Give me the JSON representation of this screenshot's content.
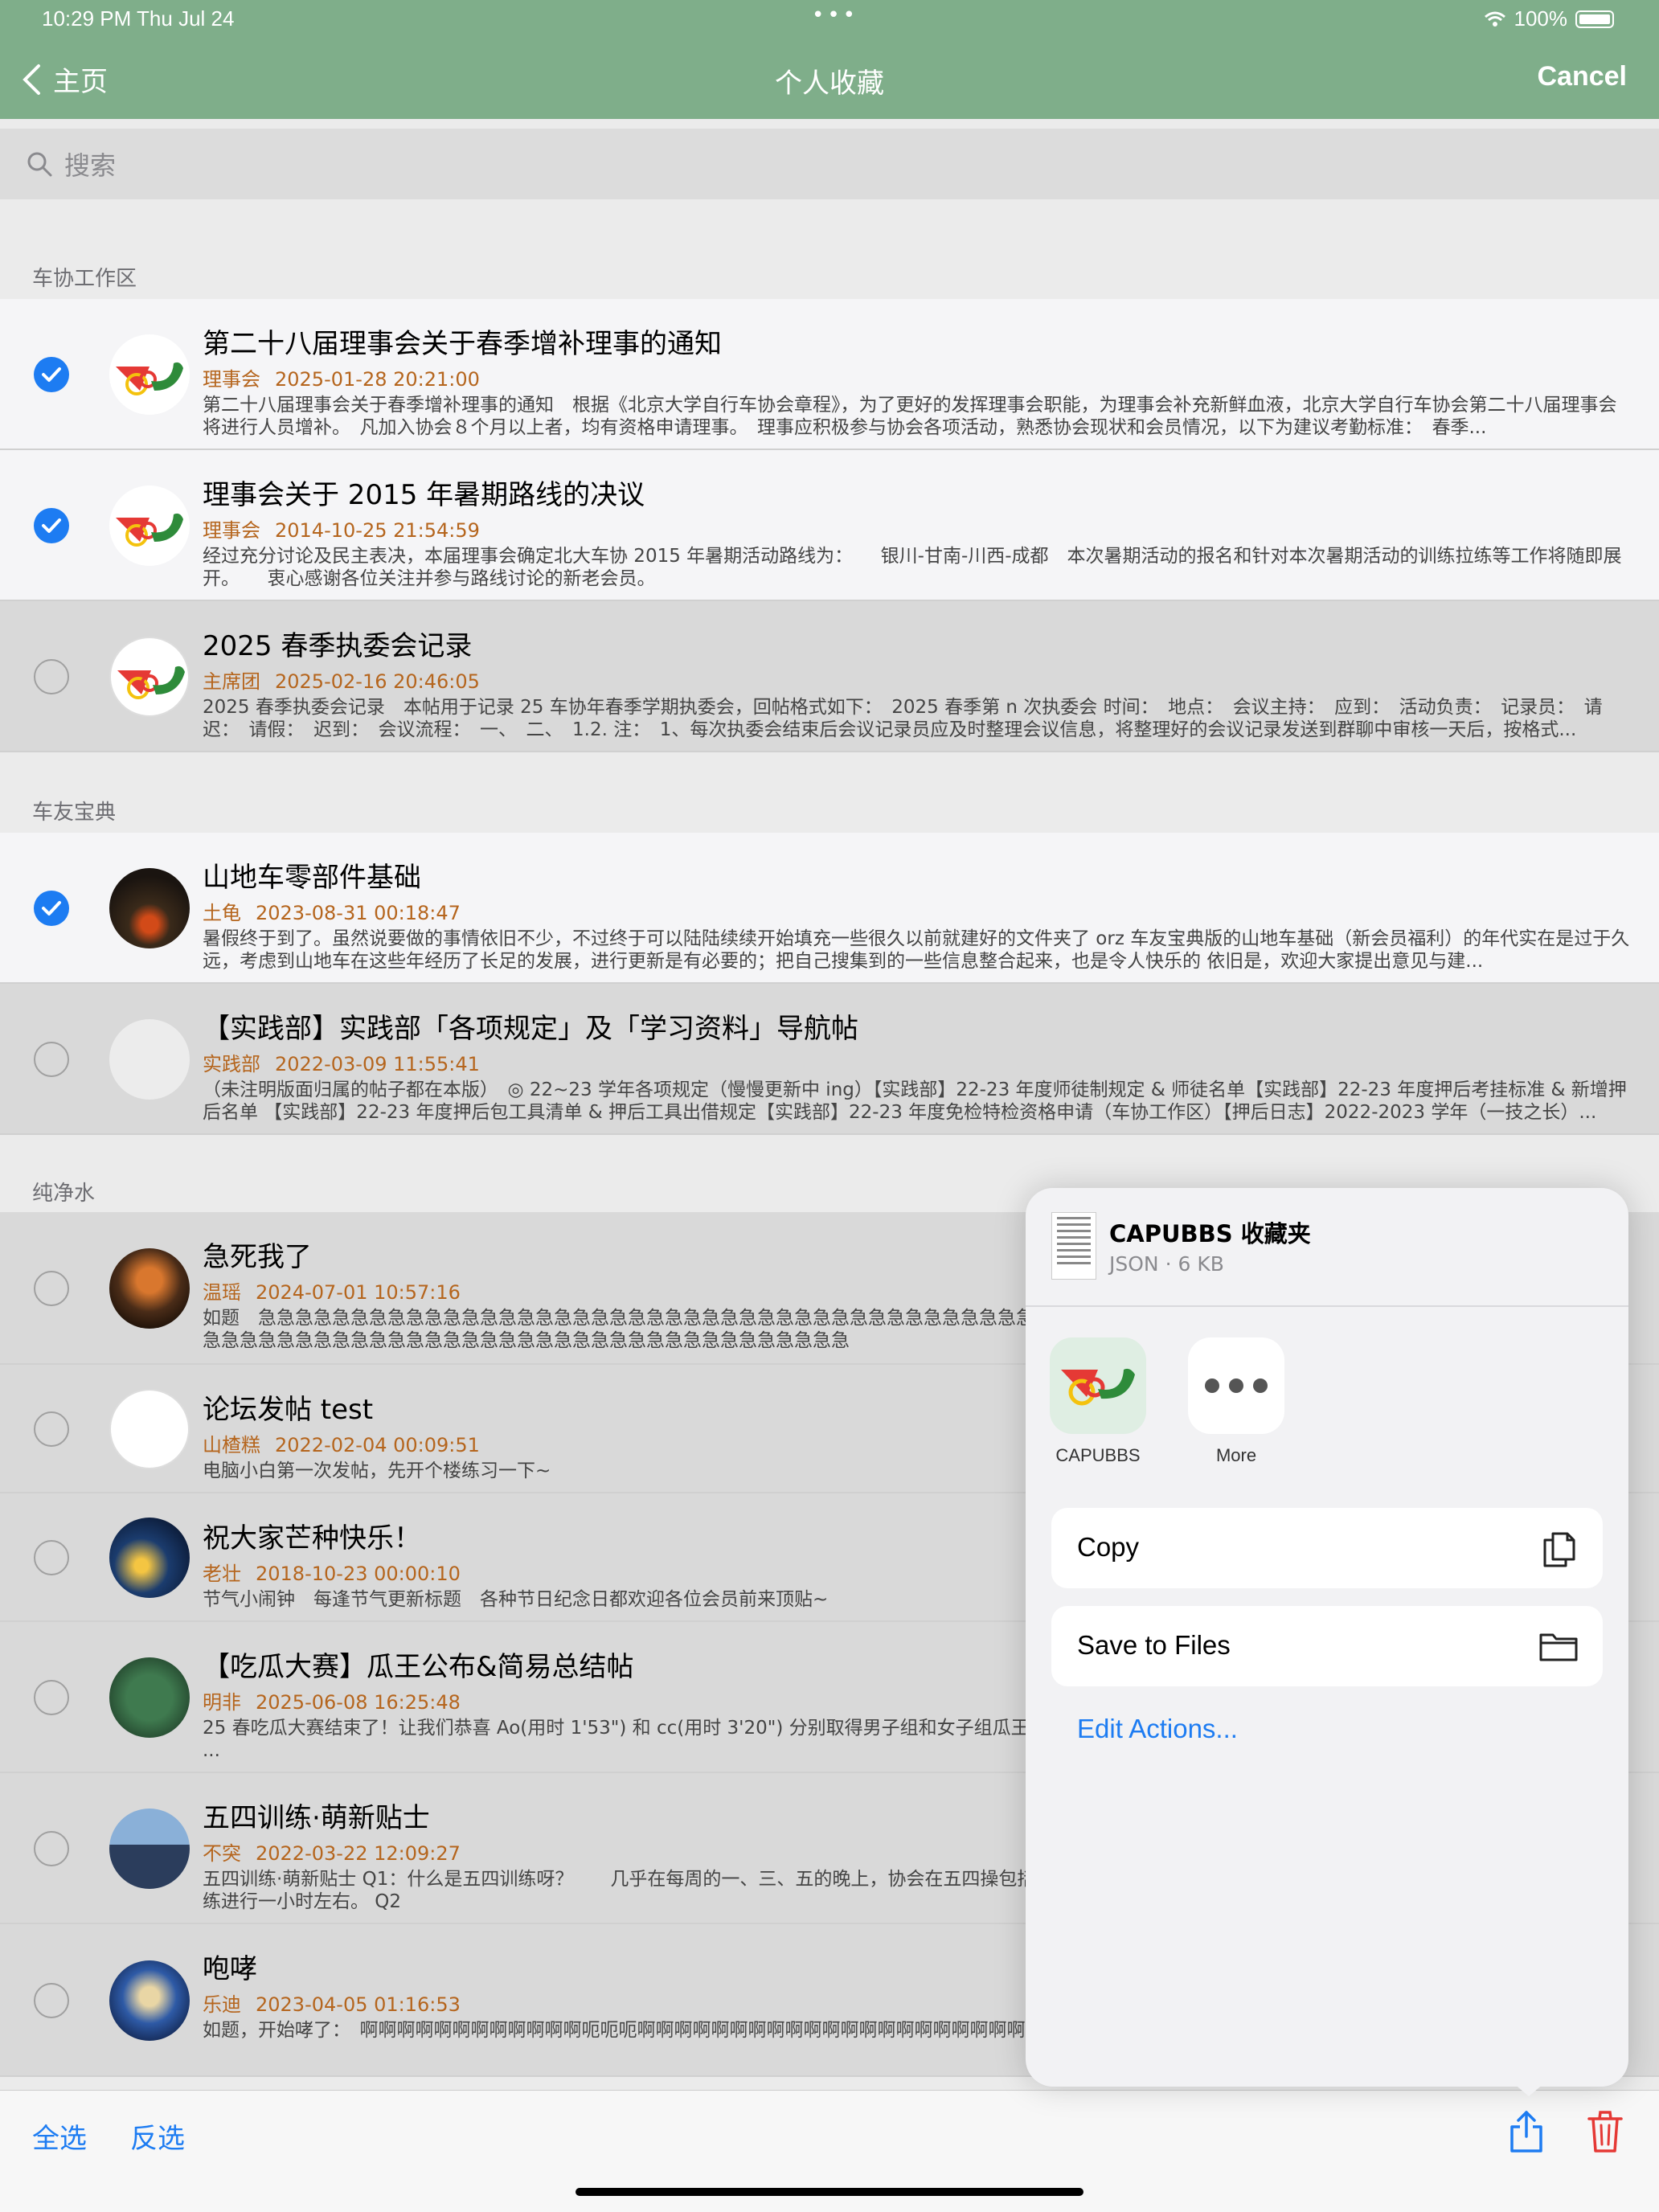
{
  "status": {
    "time": "10:29 PM   Thu Jul 24",
    "battery": "100%"
  },
  "nav": {
    "back_label": "主页",
    "title": "个人收藏",
    "cancel_label": "Cancel"
  },
  "search": {
    "placeholder": "搜索"
  },
  "sections": [
    {
      "header": "车协工作区"
    },
    {
      "header": "车友宝典"
    },
    {
      "header": "纯净水"
    }
  ],
  "rows": [
    {
      "title": "第二十八届理事会关于春季增补理事的通知",
      "author": "理事会",
      "time": "2025-01-28 20:21:00",
      "summary": "第二十八届理事会关于春季增补理事的通知　根据《北京大学自行车协会章程》，为了更好的发挥理事会职能，为理事会补充新鲜血液，北京大学自行车协会第二十八届理事会将进行人员增补。　凡加入协会８个月以上者，均有资格申请理事。　理事应积极参与协会各项活动，熟悉协会现状和会员情况，以下为建议考勤标准：　春季...",
      "selected": true
    },
    {
      "title": "理事会关于 2015 年暑期路线的决议",
      "author": "理事会",
      "time": "2014-10-25 21:54:59",
      "summary": "经过充分讨论及民主表决，本届理事会确定北大车协 2015 年暑期活动路线为：　　银川-甘南-川西-成都　本次暑期活动的报名和针对本次暑期活动的训练拉练等工作将随即展开。　　衷心感谢各位关注并参与路线讨论的新老会员。",
      "selected": true
    },
    {
      "title": "2025 春季执委会记录",
      "author": "主席团",
      "time": "2025-02-16 20:46:05",
      "summary": "2025 春季执委会记录　本帖用于记录 25 车协年春季学期执委会，回帖格式如下：　2025 春季第 n 次执委会 时间：　地点：　会议主持：　应到：　活动负责：　记录员：　请迟：　请假：　迟到：　会议流程：　一、　二、　1.2. 注：　1、每次执委会结束后会议记录员应及时整理会议信息，将整理好的会议记录发送到群聊中审核一天后，按格式...",
      "selected": false
    },
    {
      "title": "山地车零部件基础",
      "author": "土龟",
      "time": "2023-08-31 00:18:47",
      "summary": "暑假终于到了。虽然说要做的事情依旧不少，不过终于可以陆陆续续开始填充一些很久以前就建好的文件夹了 orz 车友宝典版的山地车基础（新会员福利）的年代实在是过于久远，考虑到山地车在这些年经历了长足的发展，进行更新是有必要的；把自己搜集到的一些信息整合起来，也是令人快乐的 依旧是，欢迎大家提出意见与建...",
      "selected": true
    },
    {
      "title": "【实践部】实践部「各项规定」及「学习资料」导航帖",
      "author": "实践部",
      "time": "2022-03-09 11:55:41",
      "summary": "（未注明版面归属的帖子都在本版）　◎ 22~23 学年各项规定（慢慢更新中 ing）【实践部】22-23 年度师徒制规定 & 师徒名单【实践部】22-23 年度押后考挂标准 & 新增押后名单 【实践部】22-23 年度押后包工具清单 & 押后工具出借规定【实践部】22-23 年度免检特检资格申请（车协工作区）【押后日志】2022-2023 学年（一技之长）...",
      "selected": false
    },
    {
      "title": "急死我了",
      "author": "温瑶",
      "time": "2024-07-01 10:57:16",
      "summary": "如题　急急急急急急急急急急急急急急急急急急急急急急急急急急急急急急急急急急急急急急急急急急急急急急急急急急急急急急急急急急急急急急急急急急急急急急急急急急急急急急急急急急急急急急急急急急急急急急急急急急急急急急急急急急急急急",
      "selected": false
    },
    {
      "title": "论坛发帖 test",
      "author": "山楂糕",
      "time": "2022-02-04 00:09:51",
      "summary": "电脑小白第一次发帖，先开个楼练习一下~",
      "selected": false
    },
    {
      "title": "祝大家芒种快乐！",
      "author": "老壮",
      "time": "2018-10-23 00:00:10",
      "summary": "节气小闹钟　每逢节气更新标题　各种节日纪念日都欢迎各位会员前来顶贴~",
      "selected": false
    },
    {
      "title": "【吃瓜大赛】瓜王公布&简易总结帖",
      "author": "明非",
      "time": "2025-06-08 16:25:48",
      "summary": "25 春吃瓜大赛结束了！让我们恭喜 Ao(用时 1'53\") 和 cc(用时 3'20\") 分别取得男子组和女子组瓜王人员和志愿者报名帖；6.08 吃瓜大赛　14:30 拎瓜大汉们去水果店买瓜 ...",
      "selected": false
    },
    {
      "title": "五四训练·萌新贴士",
      "author": "不突",
      "time": "2022-03-22 12:09:27",
      "summary": "五四训练·萌新贴士 Q1：什么是五四训练呀？　　几乎在每周的一、三、五的晚上，协会在五四操包括场地项目（马步、平板支撑、俯卧撑之类的）和耐力跑（就是跑圈），训练进行一小时左右。 Q2",
      "selected": false
    },
    {
      "title": "咆哮",
      "author": "乐迪",
      "time": "2023-04-05 01:16:53",
      "summary": "如题，开始哮了：　啊啊啊啊啊啊啊啊啊啊啊啊呃呃呃啊啊啊啊啊啊啊啊啊啊啊啊啊啊啊啊啊啊啊啊啊啊啊啊啊啊呃呃呃呃额啊啊啊啊啊啊啊啊",
      "selected": false
    }
  ],
  "toolbar": {
    "select_all": "全选",
    "invert": "反选"
  },
  "share_sheet": {
    "file_name": "CAPUBBS 收藏夹",
    "file_info": "JSON · 6 KB",
    "apps": [
      "CAPUBBS",
      "More"
    ],
    "actions": [
      "Copy",
      "Save to Files"
    ],
    "edit_actions": "Edit Actions..."
  },
  "colors": {
    "nav": "#7fae8a",
    "accent": "#1d7cf2",
    "meta": "#b5651d",
    "trash": "#e53935"
  },
  "icons": [
    "chevron-left-icon",
    "search-icon",
    "check-icon",
    "share-icon",
    "trash-icon",
    "copy-icon",
    "folder-icon",
    "more-icon",
    "capubbs-logo-icon"
  ]
}
